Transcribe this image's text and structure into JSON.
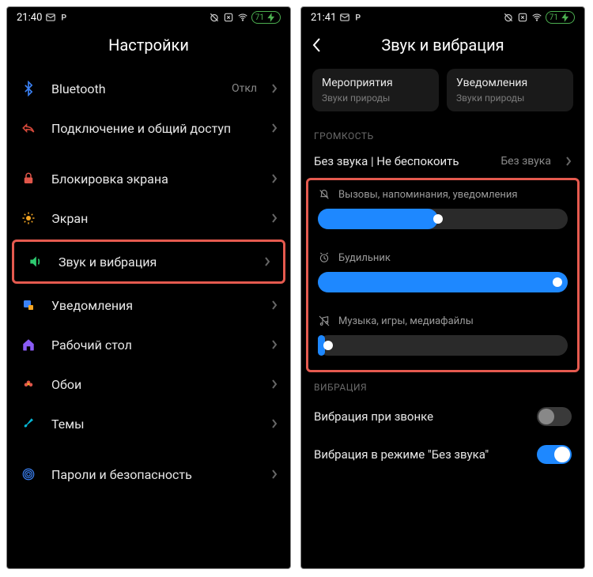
{
  "left": {
    "status": {
      "time": "21:40",
      "battery": "71"
    },
    "title": "Настройки",
    "items": [
      {
        "label": "Bluetooth",
        "value": "Откл"
      },
      {
        "label": "Подключение и общий доступ"
      },
      {
        "label": "Блокировка экрана"
      },
      {
        "label": "Экран"
      },
      {
        "label": "Звук и вибрация"
      },
      {
        "label": "Уведомления"
      },
      {
        "label": "Рабочий стол"
      },
      {
        "label": "Обои"
      },
      {
        "label": "Темы"
      },
      {
        "label": "Пароли и безопасность"
      }
    ]
  },
  "right": {
    "status": {
      "time": "21:41",
      "battery": "71"
    },
    "title": "Звук и вибрация",
    "cards": [
      {
        "title": "Мероприятия",
        "sub": "Звуки природы"
      },
      {
        "title": "Уведомления",
        "sub": "Звуки природы"
      }
    ],
    "section_volume": "ГРОМКОСТЬ",
    "silent_row": {
      "label": "Без звука | Не беспокоить",
      "value": "Без звука"
    },
    "sliders": [
      {
        "label": "Вызовы, напоминания, уведомления",
        "pct": 48
      },
      {
        "label": "Будильник",
        "pct": 100
      },
      {
        "label": "Музыка, игры, медиафайлы",
        "pct": 3
      }
    ],
    "section_vibration": "ВИБРАЦИЯ",
    "toggles": [
      {
        "label": "Вибрация при звонке",
        "on": false
      },
      {
        "label": "Вибрация в режиме \"Без звука\"",
        "on": true
      }
    ]
  }
}
